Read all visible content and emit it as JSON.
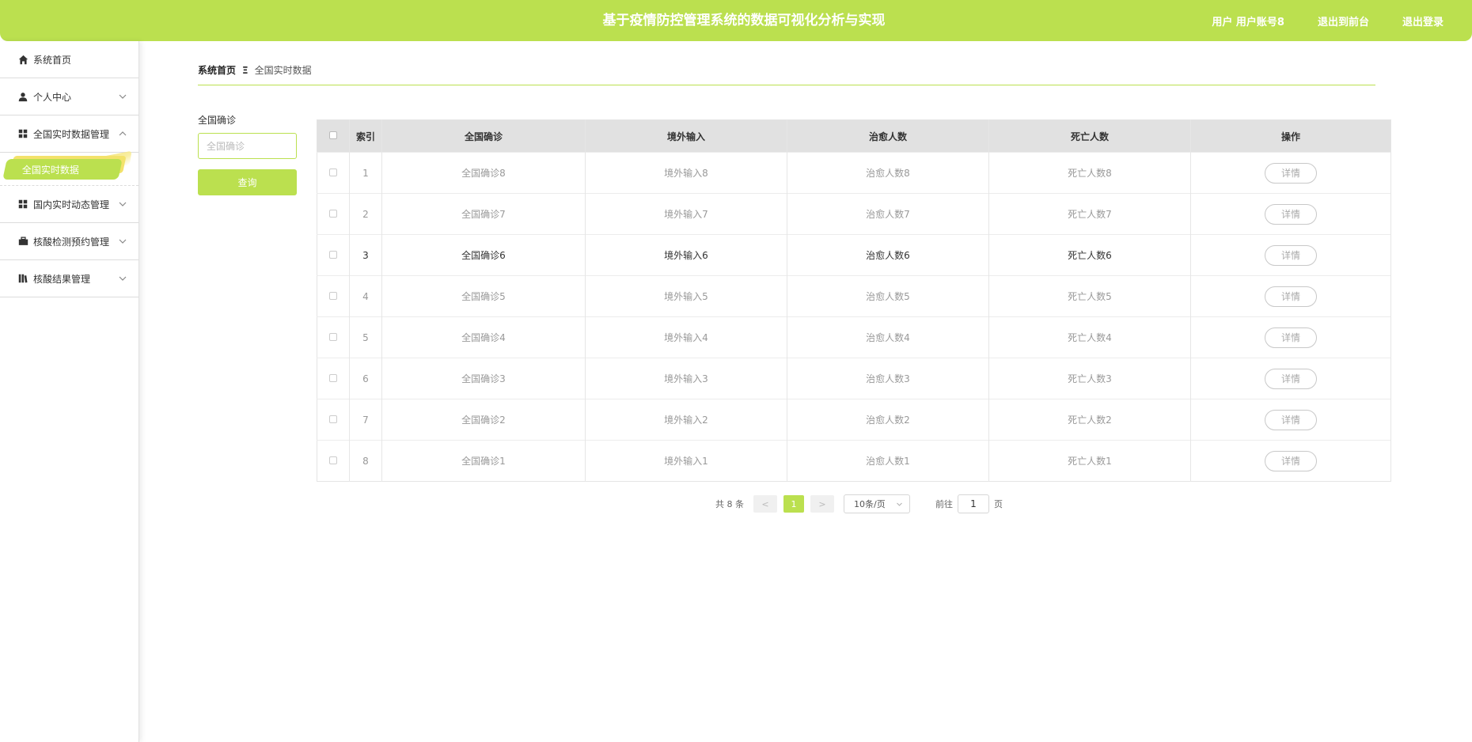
{
  "header": {
    "title": "基于疫情防控管理系统的数据可视化分析与实现",
    "user_label": "用户 用户账号8",
    "back_label": "退出到前台",
    "logout_label": "退出登录"
  },
  "sidebar": {
    "items": [
      {
        "label": "系统首页",
        "icon": "home-icon"
      },
      {
        "label": "个人中心",
        "icon": "user-icon"
      },
      {
        "label": "全国实时数据管理",
        "icon": "grid-icon",
        "expanded": true
      },
      {
        "label": "国内实时动态管理",
        "icon": "grid-icon"
      },
      {
        "label": "核酸检测预约管理",
        "icon": "briefcase-icon"
      },
      {
        "label": "核酸结果管理",
        "icon": "book-icon"
      }
    ],
    "sub_active": "全国实时数据"
  },
  "breadcrumb": {
    "home": "系统首页",
    "sep": "Ξ",
    "current": "全国实时数据"
  },
  "search": {
    "label": "全国确诊",
    "placeholder": "全国确诊",
    "button": "查询"
  },
  "table": {
    "columns": [
      "索引",
      "全国确诊",
      "境外输入",
      "治愈人数",
      "死亡人数",
      "操作"
    ],
    "rows": [
      [
        "1",
        "全国确诊8",
        "境外输入8",
        "治愈人数8",
        "死亡人数8"
      ],
      [
        "2",
        "全国确诊7",
        "境外输入7",
        "治愈人数7",
        "死亡人数7"
      ],
      [
        "3",
        "全国确诊6",
        "境外输入6",
        "治愈人数6",
        "死亡人数6"
      ],
      [
        "4",
        "全国确诊5",
        "境外输入5",
        "治愈人数5",
        "死亡人数5"
      ],
      [
        "5",
        "全国确诊4",
        "境外输入4",
        "治愈人数4",
        "死亡人数4"
      ],
      [
        "6",
        "全国确诊3",
        "境外输入3",
        "治愈人数3",
        "死亡人数3"
      ],
      [
        "7",
        "全国确诊2",
        "境外输入2",
        "治愈人数2",
        "死亡人数2"
      ],
      [
        "8",
        "全国确诊1",
        "境外输入1",
        "治愈人数1",
        "死亡人数1"
      ]
    ],
    "detail_label": "详情"
  },
  "pagination": {
    "total": "共 8 条",
    "prev": "<",
    "current": "1",
    "next": ">",
    "page_size": "10条/页",
    "goto_label": "前往",
    "goto_value": "1",
    "page_unit": "页"
  },
  "colors": {
    "accent": "#bbe04f",
    "highlight": "#f3e26b"
  }
}
